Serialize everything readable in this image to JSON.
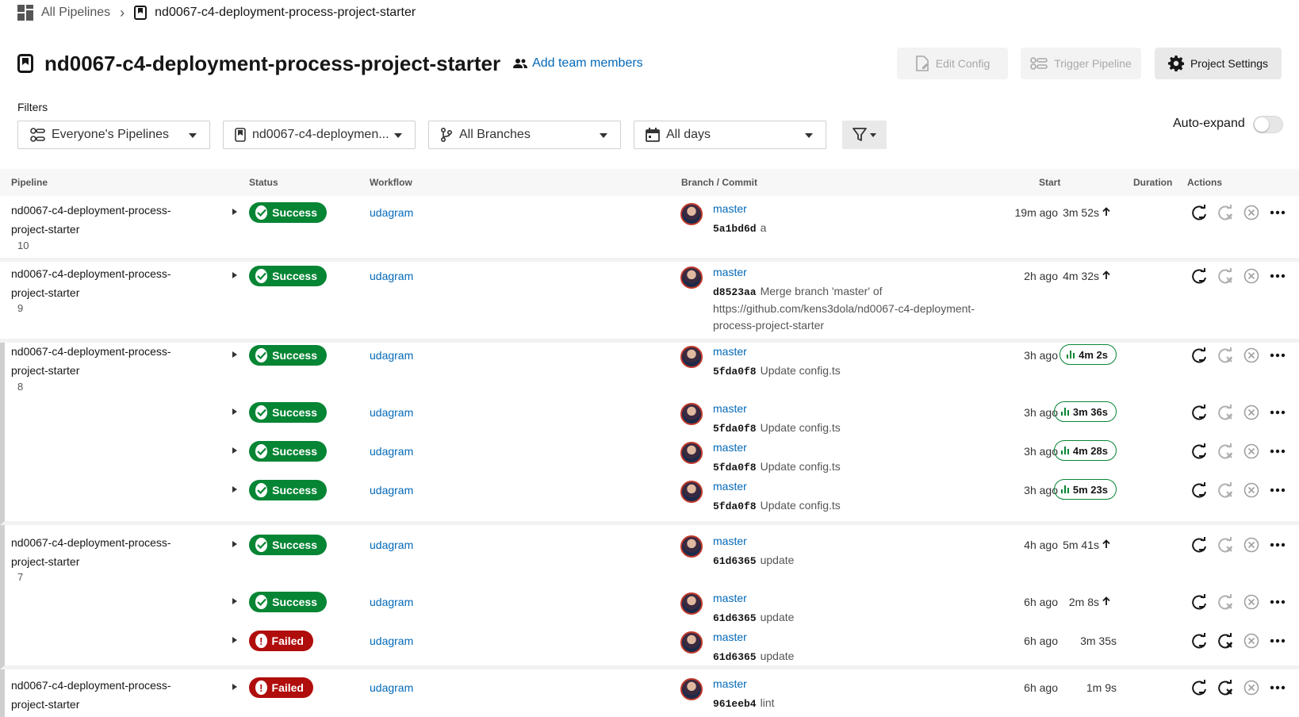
{
  "breadcrumb": {
    "all_pipelines": "All Pipelines",
    "project": "nd0067-c4-deployment-process-project-starter"
  },
  "header": {
    "title": "nd0067-c4-deployment-process-project-starter",
    "add_team": "Add team members",
    "edit_config": "Edit Config",
    "trigger_pipeline": "Trigger Pipeline",
    "project_settings": "Project Settings"
  },
  "filters": {
    "label": "Filters",
    "pipelines": "Everyone's Pipelines",
    "project": "nd0067-c4-deploymen...",
    "branches": "All Branches",
    "days": "All days",
    "auto_expand": "Auto-expand",
    "auto_expand_on": false
  },
  "table": {
    "headers": {
      "pipeline": "Pipeline",
      "status": "Status",
      "workflow": "Workflow",
      "branch_commit": "Branch / Commit",
      "start": "Start",
      "duration": "Duration",
      "actions": "Actions"
    },
    "groups": [
      {
        "name": "nd0067-c4-deployment-process-project-starter",
        "number": "10",
        "rows": [
          {
            "status": "Success",
            "workflow": "udagram",
            "branch": "master",
            "hash": "5a1bd6d",
            "message": "a",
            "start": "19m ago",
            "duration": "3m 52s",
            "duration_style": "up"
          }
        ]
      },
      {
        "name": "nd0067-c4-deployment-process-project-starter",
        "number": "9",
        "rows": [
          {
            "status": "Success",
            "workflow": "udagram",
            "branch": "master",
            "hash": "d8523aa",
            "message": "Merge branch 'master' of https://github.com/kens3dola/nd0067-c4-deployment-process-project-starter",
            "start": "2h ago",
            "duration": "4m 32s",
            "duration_style": "up"
          }
        ]
      },
      {
        "name": "nd0067-c4-deployment-process-project-starter",
        "number": "8",
        "rows": [
          {
            "status": "Success",
            "workflow": "udagram",
            "branch": "master",
            "hash": "5fda0f8",
            "message": "Update config.ts",
            "start": "3h ago",
            "duration": "4m 2s",
            "duration_style": "pill"
          },
          {
            "status": "Success",
            "workflow": "udagram",
            "branch": "master",
            "hash": "5fda0f8",
            "message": "Update config.ts",
            "start": "3h ago",
            "duration": "3m 36s",
            "duration_style": "pill"
          },
          {
            "status": "Success",
            "workflow": "udagram",
            "branch": "master",
            "hash": "5fda0f8",
            "message": "Update config.ts",
            "start": "3h ago",
            "duration": "4m 28s",
            "duration_style": "pill"
          },
          {
            "status": "Success",
            "workflow": "udagram",
            "branch": "master",
            "hash": "5fda0f8",
            "message": "Update config.ts",
            "start": "3h ago",
            "duration": "5m 23s",
            "duration_style": "pill"
          }
        ]
      },
      {
        "name": "nd0067-c4-deployment-process-project-starter",
        "number": "7",
        "rows": [
          {
            "status": "Success",
            "workflow": "udagram",
            "branch": "master",
            "hash": "61d6365",
            "message": "update",
            "start": "4h ago",
            "duration": "5m 41s",
            "duration_style": "up"
          },
          {
            "status": "Success",
            "workflow": "udagram",
            "branch": "master",
            "hash": "61d6365",
            "message": "update",
            "start": "6h ago",
            "duration": "2m 8s",
            "duration_style": "up"
          },
          {
            "status": "Failed",
            "workflow": "udagram",
            "branch": "master",
            "hash": "61d6365",
            "message": "update",
            "start": "6h ago",
            "duration": "3m 35s",
            "duration_style": "plain"
          }
        ]
      },
      {
        "name": "nd0067-c4-deployment-process-project-starter",
        "number": "",
        "rows": [
          {
            "status": "Failed",
            "workflow": "udagram",
            "branch": "master",
            "hash": "961eeb4",
            "message": "lint",
            "start": "6h ago",
            "duration": "1m 9s",
            "duration_style": "plain"
          }
        ]
      }
    ]
  },
  "colors": {
    "success": "#068534",
    "failed": "#b00d0d",
    "link": "#0369b8"
  }
}
